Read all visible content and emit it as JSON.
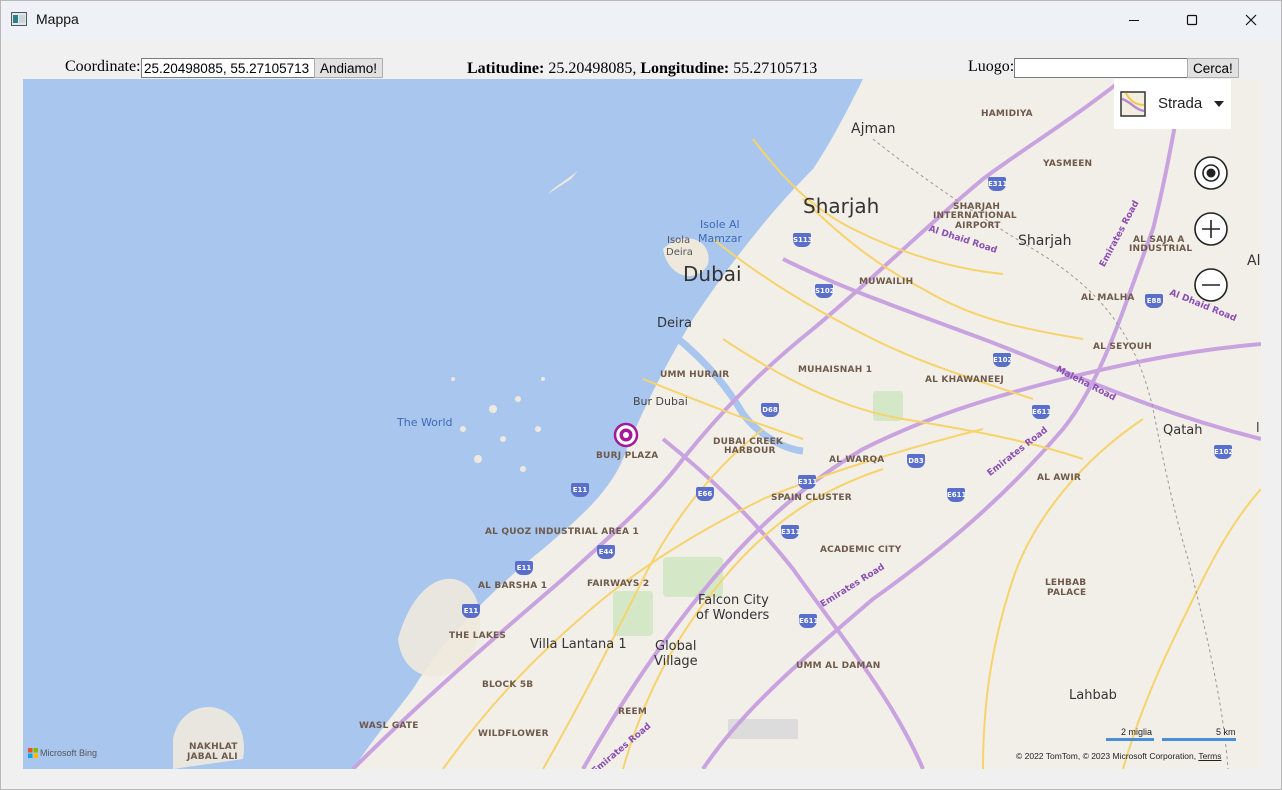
{
  "window": {
    "title": "Mappa"
  },
  "toolbar": {
    "coord_label": "Coordinate:",
    "coord_value": "25.20498085, 55.27105713",
    "go_button": "Andiamo!",
    "lat_label": "Latitudine:",
    "lat_value": "25.20498085,",
    "lon_label": "Longitudine:",
    "lon_value": "55.27105713",
    "place_label": "Luogo:",
    "place_value": "",
    "search_button": "Cerca!"
  },
  "map": {
    "style_label": "Strada",
    "bing_label": "Microsoft Bing",
    "scale_miles": "2 miglia",
    "scale_km": "5 km",
    "copyright": "© 2022 TomTom, © 2023 Microsoft Corporation,",
    "terms": "Terms",
    "labels": {
      "ajman": "Ajman",
      "hamidiya": "HAMIDIYA",
      "yasmeen": "YASMEEN",
      "sharjah_big": "Sharjah",
      "sharjah_airport_1": "SHARJAH",
      "sharjah_airport_2": "INTERNATIONAL",
      "sharjah_airport_3": "AIRPORT",
      "sharjah_small": "Sharjah",
      "al_saja_1": "AL SAJA A",
      "al_saja_2": "INDUSTRIAL",
      "al_edge": "Al",
      "isole_al_1": "Isole Al",
      "isole_al_2": "Mamzar",
      "isola_deira_1": "Isola",
      "isola_deira_2": "Deira",
      "dubai": "Dubai",
      "muwailih": "MUWAILIH",
      "al_malha": "AL MALHA",
      "deira": "Deira",
      "al_seyouh": "AL SEYOUH",
      "umm_hurair": "UMM HURAIR",
      "muhaisnah": "MUHAISNAH 1",
      "al_khawaneej": "AL KHAWANEEJ",
      "bur_dubai": "Bur Dubai",
      "the_world": "The World",
      "qatah": "Qatah",
      "l_edge": "l",
      "burj_plaza": "BURJ PLAZA",
      "dch_1": "DUBAI CREEK",
      "dch_2": "HARBOUR",
      "al_warqa": "AL WARQA",
      "al_awir": "AL AWIR",
      "spain_cluster": "SPAIN CLUSTER",
      "al_quoz": "AL QUOZ INDUSTRIAL AREA 1",
      "academic_city": "ACADEMIC CITY",
      "al_barsha": "AL BARSHA 1",
      "fairways": "FAIRWAYS 2",
      "falcon_1": "Falcon City",
      "falcon_2": "of Wonders",
      "lehbab_1": "LEHBAB",
      "lehbab_2": "PALACE",
      "the_lakes": "THE LAKES",
      "villa_lantana": "Villa Lantana 1",
      "global_1": "Global",
      "global_2": "Village",
      "umm_al_daman": "UMM AL DAMAN",
      "block_5b": "BLOCK 5B",
      "lahbab": "Lahbab",
      "reem": "REEM",
      "wasl_gate": "WASL GATE",
      "wildflower": "WILDFLOWER",
      "nakhlat_1": "NAKHLAT",
      "nakhlat_2": "JABAL ALI",
      "al_dhaid_road_1": "Al Dhaid Road",
      "al_dhaid_road_2": "Al Dhaid Road",
      "emirates_road_1": "Emirates Road",
      "emirates_road_2": "Emirates Road",
      "emirates_road_3": "Emirates Road",
      "maleha_road": "Maleha Road",
      "emirates_road_4": "Emirates Road"
    },
    "shields": {
      "e311a": "E311",
      "s113": "S113",
      "s102": "S102",
      "e88": "E88",
      "e102a": "E102",
      "d68": "D68",
      "e611a": "E611",
      "e102b": "E102",
      "d83": "D83",
      "e311b": "E311",
      "e11a": "E11",
      "e66": "E66",
      "e611b": "E611",
      "e311c": "E311",
      "e44": "E44",
      "e11b": "E11",
      "e11c": "E11",
      "e611c": "E611"
    }
  }
}
